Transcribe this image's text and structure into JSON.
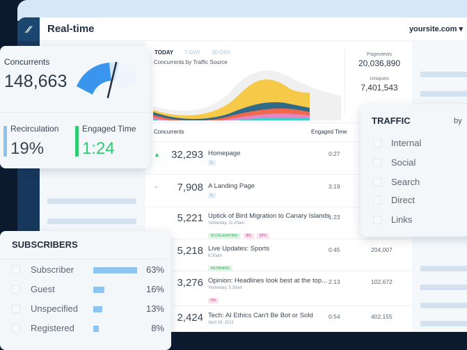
{
  "header": {
    "title": "Real-time",
    "site": "yoursite.com",
    "logo": "parsely-logo"
  },
  "chart": {
    "tabs": [
      {
        "label": "TODAY",
        "active": true
      },
      {
        "label": "7-DAY",
        "active": false
      },
      {
        "label": "30-DAY",
        "active": false
      }
    ],
    "title": "Concurrents by Traffic Source",
    "colors": {
      "yellow": "#f7c948",
      "teal_dark": "#2f6b87",
      "orange": "#f0684e",
      "pink": "#e486c2",
      "cyan": "#3ccfcf",
      "ghost": "#f0f0f0"
    }
  },
  "stats": {
    "pageviews_label": "Pageviews",
    "pageviews": "20,036,890",
    "uniques_label": "Uniques",
    "uniques": "7,401,543"
  },
  "table": {
    "headers": {
      "concurrents": "Concurrents",
      "engaged": "Engaged Time"
    },
    "rows": [
      {
        "num": "32,293",
        "title": "Homepage",
        "sub": "",
        "engaged": "0:27",
        "pageviews": "",
        "trend": "up",
        "badges": []
      },
      {
        "num": "7,908",
        "title": "A Landing Page",
        "sub": "",
        "engaged": "3:19",
        "pageviews": "",
        "trend": "down",
        "badges": []
      },
      {
        "num": "5,221",
        "title": "Uptick of Bird Migration to Canary Islands",
        "sub": "Yesterday, 11:20am",
        "engaged": "1:23",
        "pageviews": "",
        "badges": [
          {
            "text": "ACCELERATING",
            "type": "green"
          },
          {
            "text": "8%",
            "type": "pink"
          },
          {
            "text": "32%",
            "type": "pink"
          }
        ]
      },
      {
        "num": "5,218",
        "title": "Live Updates: Sports",
        "sub": "6:30am",
        "engaged": "0:45",
        "pageviews": "204,007",
        "badges": [
          {
            "text": "RETAINING",
            "type": "green"
          }
        ]
      },
      {
        "num": "3,276",
        "title": "Opinion: Headlines look best at the top...",
        "sub": "Yesterday, 5:30am",
        "engaged": "2:13",
        "pageviews": "102,672",
        "badges": [
          {
            "text": "8%",
            "type": "pink"
          }
        ]
      },
      {
        "num": "2,424",
        "title": "Tech: AI Ethics Can't Be Bot or Sold",
        "sub": "April 19, 2021",
        "engaged": "0:54",
        "pageviews": "402,155",
        "badges": []
      }
    ]
  },
  "concurrents_card": {
    "label": "Concurrents",
    "value": "148,663",
    "gauge_fraction": 0.55,
    "recirculation": {
      "label": "Recirculation",
      "value": "19%",
      "color": "#8fc3ea"
    },
    "engaged": {
      "label": "Engaged Time",
      "value": "1:24",
      "color": "#2ecc71"
    }
  },
  "subscribers": {
    "title": "SUBSCRIBERS",
    "items": [
      {
        "label": "Subscriber",
        "pct": "63%",
        "fraction": 0.63
      },
      {
        "label": "Guest",
        "pct": "16%",
        "fraction": 0.16
      },
      {
        "label": "Unspecified",
        "pct": "13%",
        "fraction": 0.13
      },
      {
        "label": "Registered",
        "pct": "8%",
        "fraction": 0.08
      }
    ]
  },
  "traffic": {
    "title": "TRAFFIC",
    "by": "by",
    "items": [
      "Internal",
      "Social",
      "Search",
      "Direct",
      "Links"
    ]
  }
}
